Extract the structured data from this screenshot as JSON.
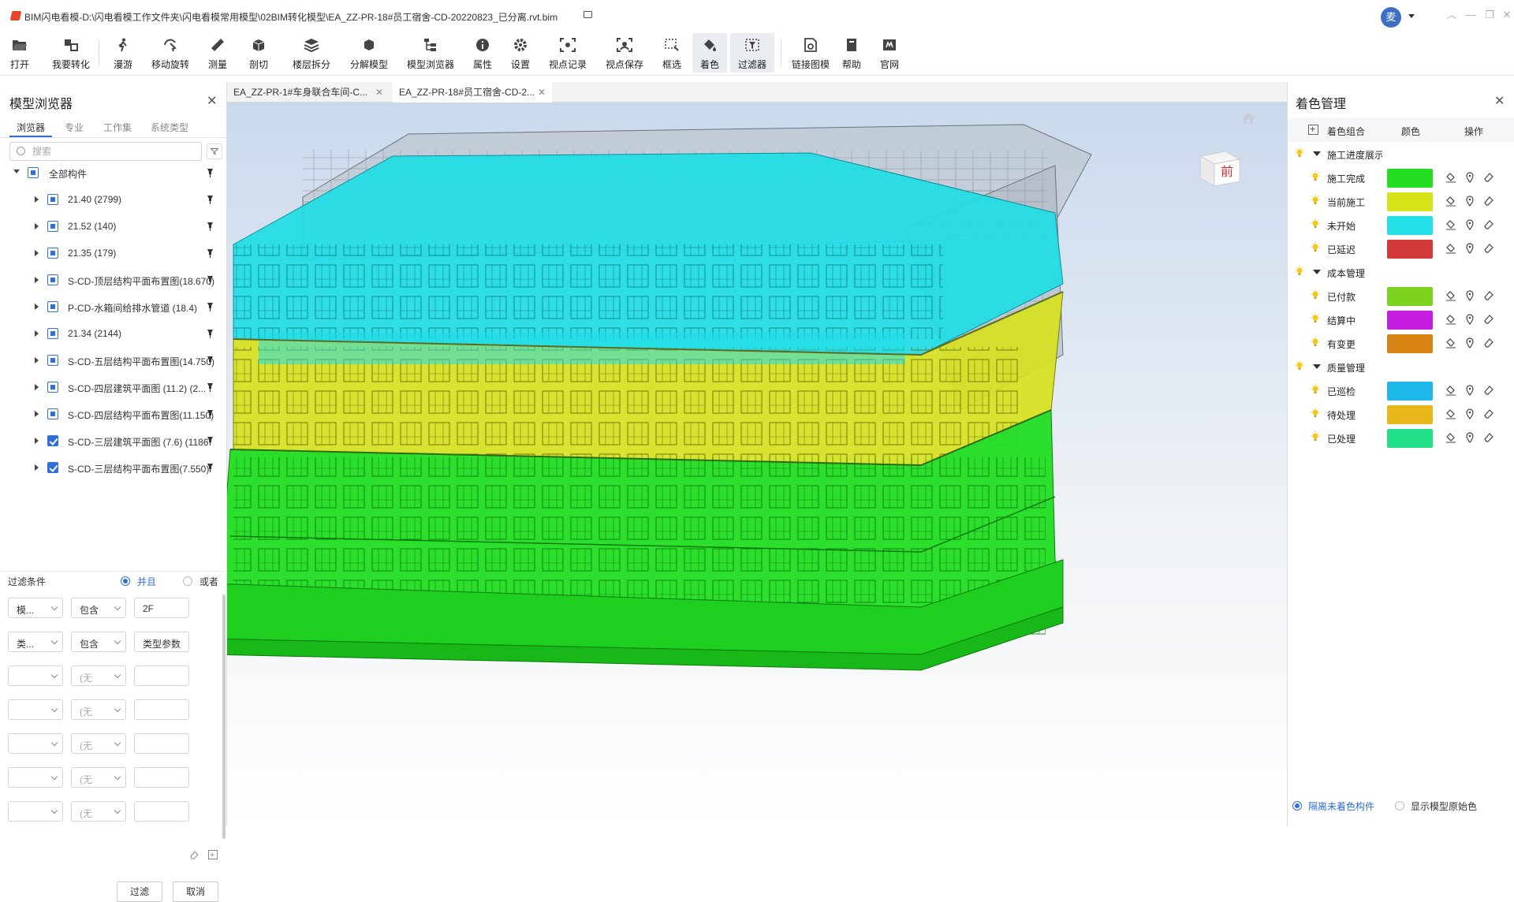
{
  "titlebar": {
    "title": "BIM闪电看模-D:\\闪电看模工作文件夹\\闪电看模常用模型\\02BIM转化模型\\EA_ZZ-PR-18#员工宿舍-CD-20220823_已分离.rvt.bim",
    "avatar_text": "麦"
  },
  "toolbar": {
    "items": [
      {
        "label": "打开",
        "icon": "folder-open-icon"
      },
      {
        "label": "我要转化",
        "icon": "convert-icon"
      },
      {
        "label": "漫游",
        "icon": "walk-icon"
      },
      {
        "label": "移动旋转",
        "icon": "orbit-icon"
      },
      {
        "label": "测量",
        "icon": "ruler-icon"
      },
      {
        "label": "剖切",
        "icon": "section-box-icon"
      },
      {
        "label": "楼层拆分",
        "icon": "layers-icon"
      },
      {
        "label": "分解模型",
        "icon": "explode-icon"
      },
      {
        "label": "模型浏览器",
        "icon": "tree-icon"
      },
      {
        "label": "属性",
        "icon": "info-icon"
      },
      {
        "label": "设置",
        "icon": "gear-icon"
      },
      {
        "label": "视点记录",
        "icon": "viewpoint-record-icon"
      },
      {
        "label": "视点保存",
        "icon": "viewpoint-save-icon"
      },
      {
        "label": "框选",
        "icon": "box-select-icon"
      },
      {
        "label": "着色",
        "icon": "paint-bucket-icon"
      },
      {
        "label": "过滤器",
        "icon": "filter-icon"
      },
      {
        "label": "链接图模",
        "icon": "link-drawing-icon"
      },
      {
        "label": "帮助",
        "icon": "help-book-icon"
      },
      {
        "label": "官网",
        "icon": "website-icon"
      }
    ]
  },
  "left_panel": {
    "title": "模型浏览器",
    "tabs": [
      "浏览器",
      "专业",
      "工作集",
      "系统类型"
    ],
    "search_placeholder": "搜索",
    "tree": {
      "root": "全部构件",
      "items": [
        {
          "label": "21.40 (2799)",
          "checked": false
        },
        {
          "label": "21.52 (140)",
          "checked": false
        },
        {
          "label": "21.35 (179)",
          "checked": false
        },
        {
          "label": "S-CD-顶层结构平面布置图(18.670)",
          "checked": false
        },
        {
          "label": "P-CD-水箱间给排水管道  (18.4)",
          "checked": false
        },
        {
          "label": "21.34 (2144)",
          "checked": false
        },
        {
          "label": "S-CD-五层结构平面布置图(14.750)",
          "checked": false
        },
        {
          "label": "S-CD-四层建筑平面图  (11.2)  (2...",
          "checked": false
        },
        {
          "label": "S-CD-四层结构平面布置图(11.150)",
          "checked": false
        },
        {
          "label": "S-CD-三层建筑平面图  (7.6)  (1186",
          "checked": true
        },
        {
          "label": "S-CD-三层结构平面布置图(7.550)",
          "checked": true
        }
      ]
    },
    "filter": {
      "title": "过滤条件",
      "mode_and": "并且",
      "mode_or": "或者",
      "rows": [
        {
          "field": "模...",
          "op": "包含",
          "value": "2F"
        },
        {
          "field": "类...",
          "op": "包含",
          "value": "类型参数"
        },
        {
          "field": "",
          "op": "(无",
          "value": ""
        },
        {
          "field": "",
          "op": "(无",
          "value": ""
        },
        {
          "field": "",
          "op": "(无",
          "value": ""
        },
        {
          "field": "",
          "op": "(无",
          "value": ""
        },
        {
          "field": "",
          "op": "(无",
          "value": ""
        }
      ],
      "apply_label": "过滤",
      "cancel_label": "取消"
    }
  },
  "doc_tabs": [
    {
      "label": "EA_ZZ-PR-1#车身联合车间-C..."
    },
    {
      "label": "EA_ZZ-PR-18#员工宿舍-CD-2..."
    }
  ],
  "viewport": {
    "viewcube_face": "前"
  },
  "right_panel": {
    "title": "着色管理",
    "header": {
      "group": "着色组合",
      "color": "颜色",
      "action": "操作"
    },
    "groups": [
      {
        "name": "施工进度展示",
        "items": [
          {
            "label": "施工完成",
            "color": "#22dd22"
          },
          {
            "label": "当前施工",
            "color": "#d4e21a"
          },
          {
            "label": "未开始",
            "color": "#22e0e6"
          },
          {
            "label": "已延迟",
            "color": "#d33b3b"
          }
        ]
      },
      {
        "name": "成本管理",
        "items": [
          {
            "label": "已付款",
            "color": "#7ed321"
          },
          {
            "label": "结算中",
            "color": "#c61ee0"
          },
          {
            "label": "有变更",
            "color": "#d88414"
          }
        ]
      },
      {
        "name": "质量管理",
        "items": [
          {
            "label": "已巡检",
            "color": "#1fb8ea"
          },
          {
            "label": "待处理",
            "color": "#e8b81a"
          },
          {
            "label": "已处理",
            "color": "#22e08a"
          }
        ]
      }
    ],
    "footer": {
      "isolate_label": "隔离未着色构件",
      "original_label": "显示模型原始色"
    }
  }
}
